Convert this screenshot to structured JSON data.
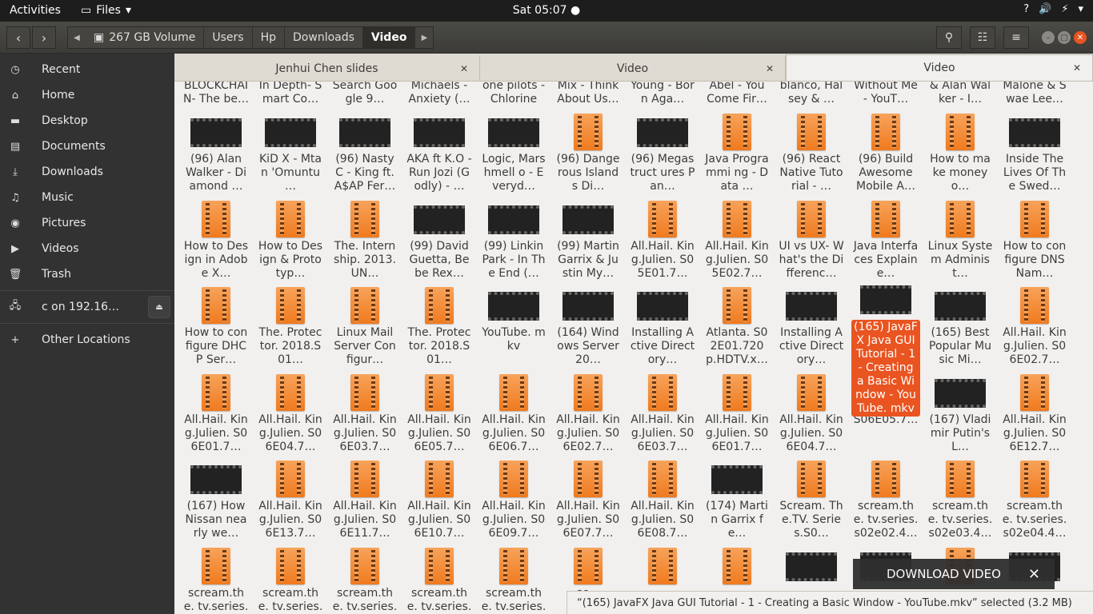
{
  "topbar": {
    "activities": "Activities",
    "app_name": "Files",
    "clock": "Sat 05:07",
    "help": "?",
    "volume": "🔊",
    "battery": "⚡"
  },
  "toolbar": {
    "back": "‹",
    "forward": "›",
    "crumbs": [
      "267 GB Volume",
      "Users",
      "Hp",
      "Downloads",
      "Video"
    ],
    "search_icon": "search-icon",
    "view_icon": "view-toggle-icon",
    "menu_icon": "menu-icon"
  },
  "sidebar": {
    "items": [
      {
        "label": "Recent",
        "icon": "◷"
      },
      {
        "label": "Home",
        "icon": "⌂"
      },
      {
        "label": "Desktop",
        "icon": "▬"
      },
      {
        "label": "Documents",
        "icon": "▤"
      },
      {
        "label": "Downloads",
        "icon": "⤓"
      },
      {
        "label": "Music",
        "icon": "♫"
      },
      {
        "label": "Pictures",
        "icon": "◉"
      },
      {
        "label": "Videos",
        "icon": "▶"
      },
      {
        "label": "Trash",
        "icon": "🗑"
      }
    ],
    "network": {
      "label": "c on 192.16…",
      "icon": "🖧"
    },
    "other": {
      "label": "Other Locations",
      "icon": "+"
    }
  },
  "tabs": [
    {
      "label": "Jenhui Chen slides"
    },
    {
      "label": "Video"
    },
    {
      "label": "Video"
    }
  ],
  "files": {
    "row0": [
      "BLOCKCHAI N- The be…",
      "In Depth- Smart Co…",
      "Search Google 9…",
      "Michaels - Anxiety (…",
      "one pilots - Chlorine (…",
      "Mix - Think About Us…",
      "Young - Born Aga…",
      "Abel - You Come Fir…",
      "blanco, Halsey & …",
      "Without Me - YouT…",
      "& Alan Walker - I…",
      "Malone & Swae Lee…"
    ],
    "row1": [
      "(96) Alan Walker - Diamond …",
      "KiD X - Mtan 'Omuntu …",
      "(96) Nasty C - King ft. A$AP Fer…",
      "AKA ft K.O - Run Jozi (Godly) - …",
      "Logic, Marshmell o - Everyd…",
      "(96) Dangerous Islands Di…",
      "(96) Megastruct ures Pan…",
      "Java Programmi ng - Data …",
      "(96) React Native Tutorial - …",
      "(96) Build Awesome Mobile A…",
      "How to make money o…",
      "Inside The Lives Of The Swed…"
    ],
    "row2": [
      "How to Design in Adobe X…",
      "How to Design & Prototyp…",
      "The. Internship. 2013.UN…",
      "(99) David Guetta, Bebe Rex…",
      "(99) Linkin Park - In The End (…",
      "(99) Martin Garrix & Justin My…",
      "All.Hail. King.Julien. S05E01.7…",
      "All.Hail. King.Julien. S05E02.7…",
      "UI vs UX- What's the Differenc…",
      "Java Interfaces Explaine…",
      "Linux System Administ…",
      "How to configure DNS Nam…"
    ],
    "row3": [
      "How to configure DHCP Ser…",
      "The. Protector. 2018.S01…",
      "Linux Mail Server Configur…",
      "The. Protector. 2018.S01…",
      "YouTube. mkv",
      "(164) Windows Server 20…",
      "Installing Active Directory…",
      "Atlanta. S02E01.720 p.HDTV.x…",
      "Installing Active Directory…",
      "(165) JavaFX Java GUI Tutorial - 1 - Creating a Basic Window - YouTube. mkv",
      "(165) Best Popular Music Mi…",
      "All.Hail. King.Julien. S06E02.7…"
    ],
    "row4": [
      "All.Hail. King.Julien. S06E01.7…",
      "All.Hail. King.Julien. S06E04.7…",
      "All.Hail. King.Julien. S06E03.7…",
      "All.Hail. King.Julien. S06E05.7…",
      "All.Hail. King.Julien. S06E06.7…",
      "All.Hail. King.Julien. S06E02.7…",
      "All.Hail. King.Julien. S06E03.7…",
      "All.Hail. King.Julien. S06E01.7…",
      "All.Hail. King.Julien. S06E04.7…",
      "S06E05.7…",
      "(167) Vladimir Putin's L…",
      "All.Hail. King.Julien. S06E12.7…"
    ],
    "row5": [
      "(167) How Nissan nearly we…",
      "All.Hail. King.Julien. S06E13.7…",
      "All.Hail. King.Julien. S06E11.7…",
      "All.Hail. King.Julien. S06E10.7…",
      "All.Hail. King.Julien. S06E09.7…",
      "All.Hail. King.Julien. S06E07.7…",
      "All.Hail. King.Julien. S06E08.7…",
      "(174) Martin Garrix fe…",
      "Scream. The.TV. Series.S0…",
      "scream.the. tv.series. s02e02.4…",
      "scream.the. tv.series. s02e03.4…",
      "scream.the. tv.series. s02e04.4…"
    ],
    "row6": [
      "scream.the. tv.series.",
      "scream.the. tv.series.",
      "scream.the. tv.series.",
      "scream.the. tv.series.",
      "scream.the. tv.series.",
      "sc…",
      "",
      "",
      "",
      "",
      "",
      ""
    ]
  },
  "toast": {
    "label": "DOWNLOAD VIDEO",
    "close": "✕"
  },
  "status": {
    "text": "“(165) JavaFX Java GUI Tutorial - 1 - Creating a Basic Window - YouTube.mkv” selected  (3.2 MB)"
  },
  "colors": {
    "accent": "#e95420",
    "sidebar": "#323232",
    "header": "#3c3b37"
  }
}
